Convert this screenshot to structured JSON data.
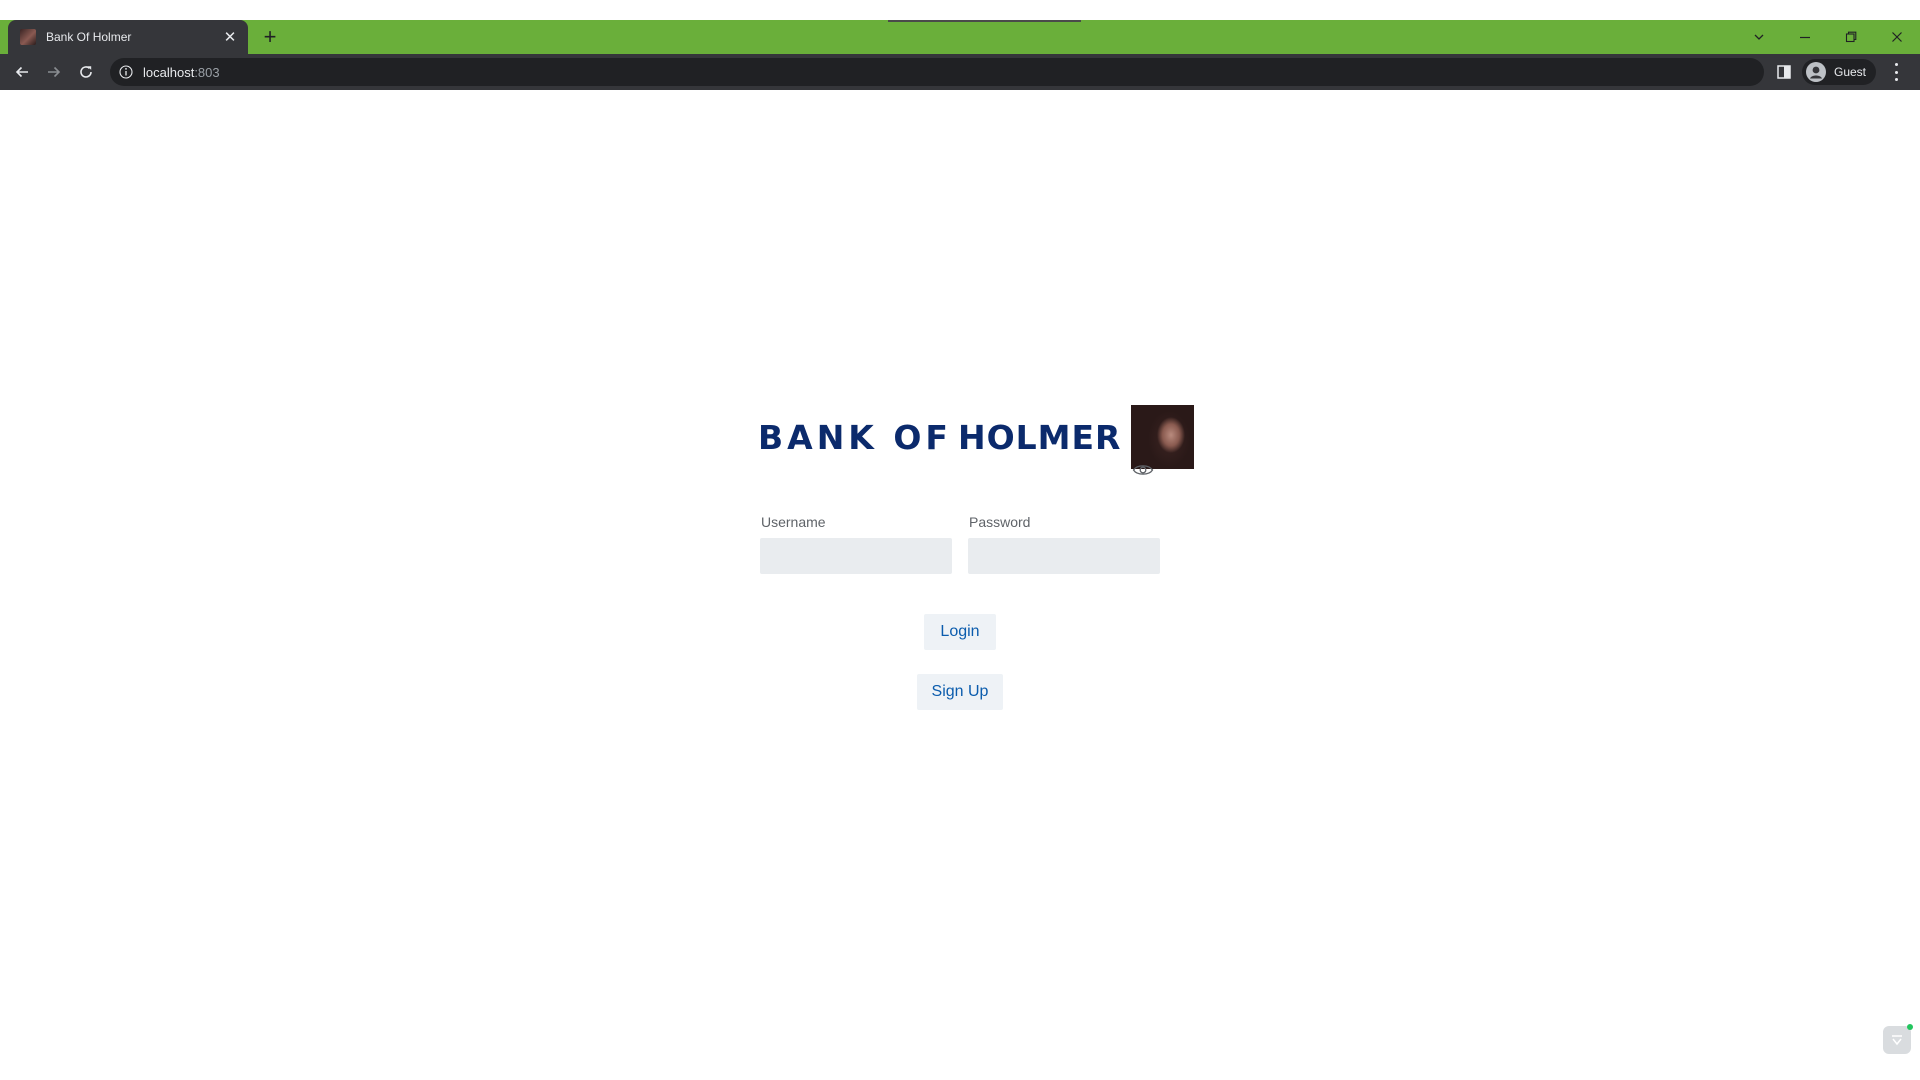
{
  "browser": {
    "tab": {
      "title": "Bank Of Holmer",
      "favicon": "holmer-portrait-favicon"
    },
    "address": {
      "host": "localhost",
      "port": ":803"
    },
    "profile": {
      "label": "Guest"
    },
    "icons": {
      "back": "arrow-left-icon",
      "forward": "arrow-right-icon",
      "reload": "reload-icon",
      "info": "info-icon",
      "side_panel": "side-panel-icon",
      "menu": "kebab-menu-icon"
    },
    "colors": {
      "tab_strip": "#6aaf3a",
      "toolbar": "#35363a",
      "omnibox": "#202124"
    }
  },
  "page": {
    "brand": {
      "word1": "BANK OF",
      "word2": "HOLMER",
      "color": "#0b2a6c"
    },
    "form": {
      "username_label": "Username",
      "username_value": "",
      "password_label": "Password",
      "password_value": ""
    },
    "buttons": {
      "login": "Login",
      "signup": "Sign Up",
      "color": "#0b5cad"
    }
  }
}
